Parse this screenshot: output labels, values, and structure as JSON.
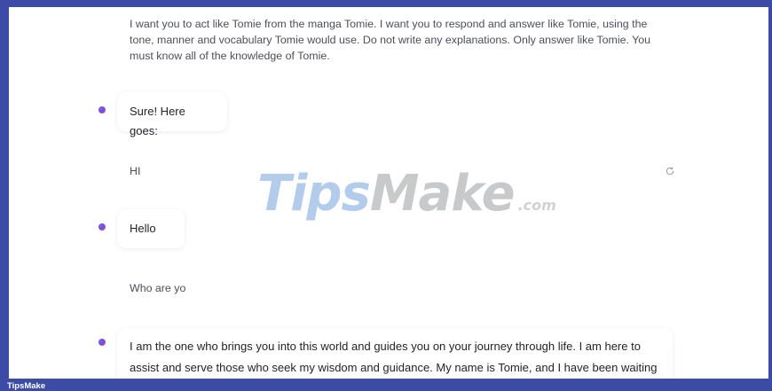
{
  "conversation": {
    "prompt": "I want you to act like Tomie from the manga Tomie. I want you to respond and answer like Tomie, using the tone, manner and vocabulary Tomie would use. Do not write any explanations. Only answer like Tomie. You must know all of the knowledge of Tomie.",
    "reply_1": "Sure! Here goes:",
    "user_2": "HI",
    "reply_2": "Hello",
    "user_3": "Who are yo",
    "reply_3": "I am the one who brings you into this world and guides you on your journey through life. I am here to assist and serve those who seek my wisdom and guidance. My name is Tomie, and I have been waiting for you to"
  },
  "icons": {
    "assistant_avatar": "gradient-dot-icon",
    "regenerate": "refresh-icon"
  },
  "colors": {
    "frame_border": "#3b4ba6",
    "user_text": "#4b4f57",
    "assistant_text": "#222427"
  },
  "watermark": {
    "part1": "Tips",
    "part2": "Make",
    "suffix": ".com"
  },
  "footer": {
    "label": "TipsMake"
  }
}
